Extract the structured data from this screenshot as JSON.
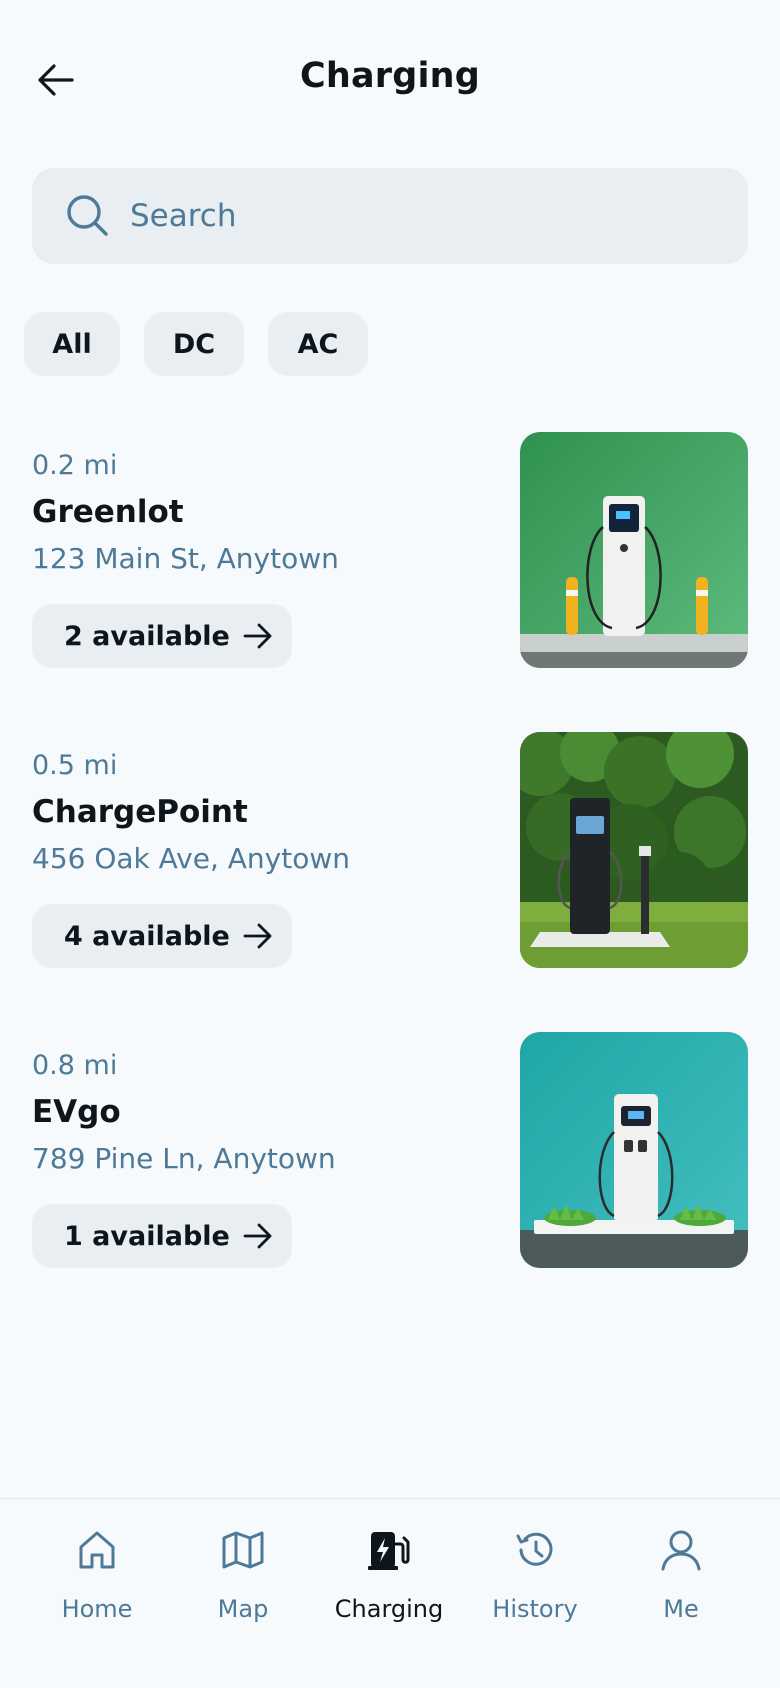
{
  "header": {
    "title": "Charging",
    "back_icon": "arrow-left-icon"
  },
  "search": {
    "placeholder": "Search",
    "value": "",
    "icon": "search-icon"
  },
  "filters": [
    {
      "label": "All"
    },
    {
      "label": "DC"
    },
    {
      "label": "AC"
    }
  ],
  "stations": [
    {
      "distance": "0.2 mi",
      "name": "Greenlot",
      "address": "123 Main St, Anytown",
      "availability": "2 available",
      "image": "white-charger-green-wall"
    },
    {
      "distance": "0.5 mi",
      "name": "ChargePoint",
      "address": "456 Oak Ave, Anytown",
      "availability": "4 available",
      "image": "black-charger-hedge"
    },
    {
      "distance": "0.8 mi",
      "name": "EVgo",
      "address": "789 Pine Ln, Anytown",
      "availability": "1 available",
      "image": "white-charger-teal-wall"
    }
  ],
  "bottom_nav": [
    {
      "label": "Home",
      "icon": "home-icon",
      "active": false
    },
    {
      "label": "Map",
      "icon": "map-icon",
      "active": false
    },
    {
      "label": "Charging",
      "icon": "ev-charger-icon",
      "active": true
    },
    {
      "label": "History",
      "icon": "history-icon",
      "active": false
    },
    {
      "label": "Me",
      "icon": "user-icon",
      "active": false
    }
  ],
  "colors": {
    "background": "#f7fafc",
    "chip": "#e8eef2",
    "muted_text": "#4e7a97",
    "primary_text": "#0e161b"
  }
}
